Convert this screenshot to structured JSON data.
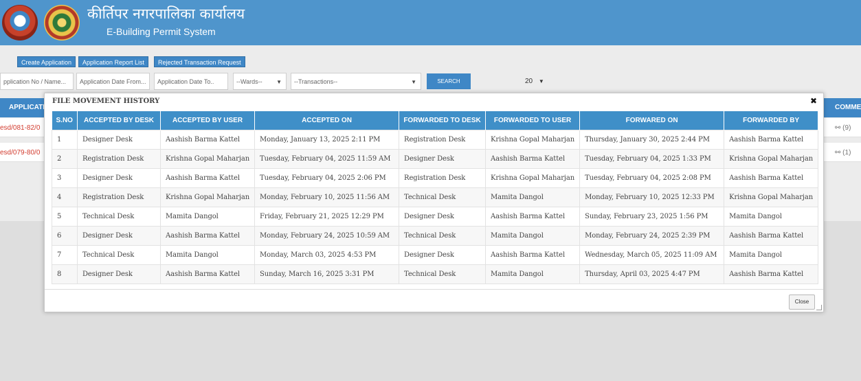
{
  "header": {
    "office_title": "कीर्तिपर नगरपालिका कार्यालय",
    "system_title": "E-Building Permit System"
  },
  "toolbar": {
    "nav": [
      "Create Application",
      "Application Report List",
      "Rejected Transaction Request"
    ],
    "filters": {
      "app_no_placeholder": "pplication No / Name...",
      "date_from_placeholder": "Application Date From...",
      "date_to_placeholder": "Application Date To..",
      "wards_selected": "--Wards--",
      "transactions_selected": "--Transactions--",
      "search_label": "SEARCH",
      "page_size": "20"
    }
  },
  "background_list": {
    "col_application": "APPLICATIO",
    "col_comment": "COMME",
    "rows": [
      {
        "app": "esd/081-82/0",
        "comment": "(9)"
      },
      {
        "app": "esd/079-80/0",
        "comment": "(1)"
      }
    ]
  },
  "modal": {
    "title": "FILE MOVEMENT HISTORY",
    "close_label": "Close",
    "columns": [
      "S.NO",
      "ACCEPTED BY DESK",
      "ACCEPTED BY USER",
      "ACCEPTED ON",
      "FORWARDED TO DESK",
      "FORWARDED TO USER",
      "FORWARED ON",
      "FORWARDED BY"
    ],
    "rows": [
      [
        "1",
        "Designer Desk",
        "Aashish Barma Kattel",
        "Monday, January 13, 2025 2:11 PM",
        "Registration Desk",
        "Krishna Gopal Maharjan",
        "Thursday, January 30, 2025 2:44 PM",
        "Aashish Barma Kattel"
      ],
      [
        "2",
        "Registration Desk",
        "Krishna Gopal Maharjan",
        "Tuesday, February 04, 2025 11:59 AM",
        "Designer Desk",
        "Aashish Barma Kattel",
        "Tuesday, February 04, 2025 1:33 PM",
        "Krishna Gopal Maharjan"
      ],
      [
        "3",
        "Designer Desk",
        "Aashish Barma Kattel",
        "Tuesday, February 04, 2025 2:06 PM",
        "Registration Desk",
        "Krishna Gopal Maharjan",
        "Tuesday, February 04, 2025 2:08 PM",
        "Aashish Barma Kattel"
      ],
      [
        "4",
        "Registration Desk",
        "Krishna Gopal Maharjan",
        "Monday, February 10, 2025 11:56 AM",
        "Technical Desk",
        "Mamita Dangol",
        "Monday, February 10, 2025 12:33 PM",
        "Krishna Gopal Maharjan"
      ],
      [
        "5",
        "Technical Desk",
        "Mamita Dangol",
        "Friday, February 21, 2025 12:29 PM",
        "Designer Desk",
        "Aashish Barma Kattel",
        "Sunday, February 23, 2025 1:56 PM",
        "Mamita Dangol"
      ],
      [
        "6",
        "Designer Desk",
        "Aashish Barma Kattel",
        "Monday, February 24, 2025 10:59 AM",
        "Technical Desk",
        "Mamita Dangol",
        "Monday, February 24, 2025 2:39 PM",
        "Aashish Barma Kattel"
      ],
      [
        "7",
        "Technical Desk",
        "Mamita Dangol",
        "Monday, March 03, 2025 4:53 PM",
        "Designer Desk",
        "Aashish Barma Kattel",
        "Wednesday, March 05, 2025 11:09 AM",
        "Mamita Dangol"
      ],
      [
        "8",
        "Designer Desk",
        "Aashish Barma Kattel",
        "Sunday, March 16, 2025 3:31 PM",
        "Technical Desk",
        "Mamita Dangol",
        "Thursday, April 03, 2025 4:47 PM",
        "Aashish Barma Kattel"
      ]
    ]
  }
}
